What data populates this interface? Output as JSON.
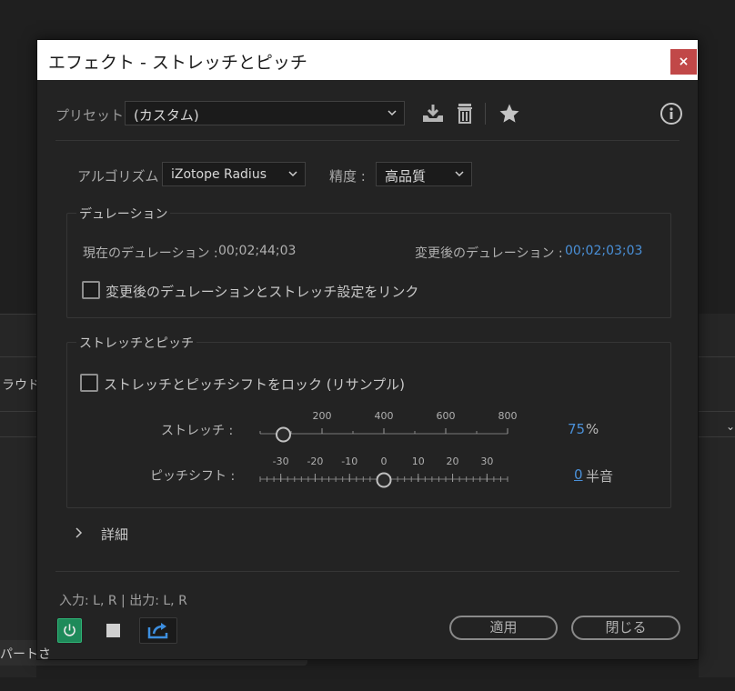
{
  "background": {
    "left_text_1": "ラウド:",
    "left_text_2": "パートさ"
  },
  "dialog": {
    "title": "エフェクト - ストレッチとピッチ",
    "close_label": "×"
  },
  "preset": {
    "label": "プリセット :",
    "value": "(カスタム)"
  },
  "algorithm": {
    "label": "アルゴリズム :",
    "value": "iZotope Radius"
  },
  "precision": {
    "label": "精度 :",
    "value": "高品質"
  },
  "duration": {
    "legend": "デュレーション",
    "current_label": "現在のデュレーション :",
    "current_value": "00;02;44;03",
    "new_label": "変更後のデュレーション :",
    "new_value": "00;02;03;03",
    "link_label": "変更後のデュレーションとストレッチ設定をリンク",
    "link_checked": false
  },
  "stretch_pitch": {
    "legend": "ストレッチとピッチ",
    "lock_label": "ストレッチとピッチシフトをロック (リサンプル)",
    "lock_checked": false,
    "stretch": {
      "label": "ストレッチ :",
      "ticks": [
        "200",
        "400",
        "600",
        "800"
      ],
      "value": "75",
      "unit": "%",
      "min": 0,
      "max": 800
    },
    "pitch": {
      "label": "ピッチシフト :",
      "ticks": [
        "-30",
        "-20",
        "-10",
        "0",
        "10",
        "20",
        "30"
      ],
      "value": "0",
      "unit": "半音",
      "min": -36,
      "max": 36
    }
  },
  "details": {
    "label": "詳細"
  },
  "footer": {
    "io": "入力: L, R | 出力: L, R",
    "apply_label": "適用",
    "close_label": "閉じる"
  },
  "colors": {
    "accent_blue": "#4a90d8",
    "power_green": "#1e8a5a",
    "close_red": "#c14848"
  }
}
